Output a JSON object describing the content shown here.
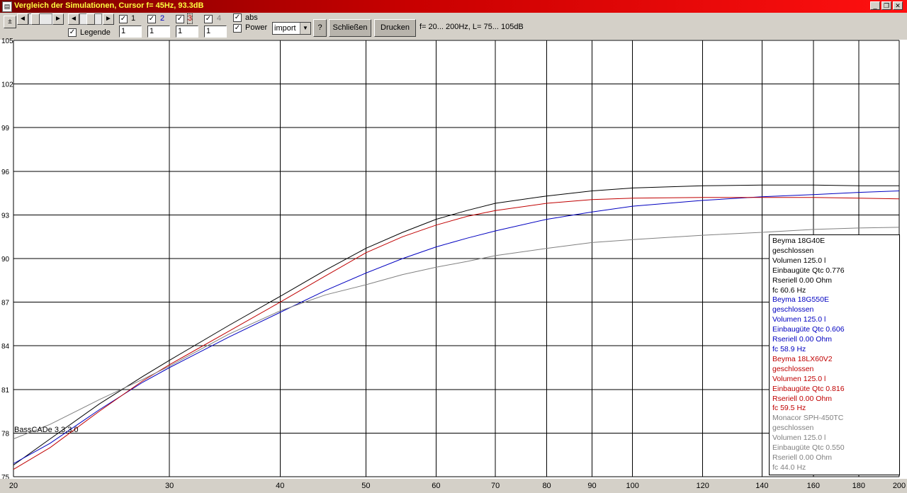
{
  "window": {
    "title": "Vergleich der Simulationen, Cursor f= 45Hz, 93.3dB",
    "icon": "document-icon"
  },
  "toolbar": {
    "plusminus_label": "±",
    "left_arrow": "◄",
    "right_arrow": "►",
    "legend_label": "Legende",
    "legend_checked": true,
    "series_toggles": [
      {
        "label": "1",
        "checked": true,
        "color": "#000000"
      },
      {
        "label": "2",
        "checked": true,
        "color": "#0000c0"
      },
      {
        "label": "3",
        "checked": true,
        "color": "#c00000"
      },
      {
        "label": "4",
        "checked": true,
        "color": "#808080"
      }
    ],
    "multipliers": [
      "1",
      "1",
      "1",
      "1"
    ],
    "abs_label": "abs",
    "abs_checked": true,
    "power_label": "Power",
    "power_checked": true,
    "import_value": "import",
    "help_label": "?",
    "close_label": "Schließen",
    "print_label": "Drucken",
    "range_info": "f=  20... 200Hz, L= 75... 105dB"
  },
  "chart_data": {
    "type": "line",
    "x_scale": "log",
    "xlim": [
      20,
      200
    ],
    "ylim": [
      75,
      105
    ],
    "x_ticks": [
      20,
      30,
      40,
      50,
      60,
      70,
      80,
      90,
      100,
      120,
      140,
      160,
      180,
      200
    ],
    "y_ticks": [
      75,
      78,
      81,
      84,
      87,
      90,
      93,
      96,
      99,
      102,
      105
    ],
    "grid": true,
    "legend_position": "bottom-right",
    "series": [
      {
        "color": "#000000",
        "x": [
          20,
          22,
          25,
          28,
          30,
          35,
          40,
          45,
          50,
          55,
          60,
          65,
          70,
          80,
          90,
          100,
          120,
          140,
          160,
          180,
          200
        ],
        "y": [
          75.8,
          77.6,
          80.0,
          81.9,
          83.0,
          85.4,
          87.4,
          89.2,
          90.7,
          91.8,
          92.7,
          93.3,
          93.8,
          94.3,
          94.65,
          94.85,
          95.0,
          95.05,
          95.05,
          95.0,
          95.0
        ]
      },
      {
        "color": "#0000c0",
        "x": [
          20,
          22,
          25,
          28,
          30,
          35,
          40,
          45,
          50,
          55,
          60,
          65,
          70,
          80,
          90,
          100,
          120,
          140,
          160,
          180,
          200
        ],
        "y": [
          75.9,
          77.3,
          79.6,
          81.5,
          82.5,
          84.6,
          86.3,
          87.8,
          89.0,
          90.0,
          90.8,
          91.4,
          91.9,
          92.7,
          93.2,
          93.6,
          94.0,
          94.25,
          94.4,
          94.55,
          94.65
        ]
      },
      {
        "color": "#c00000",
        "x": [
          20,
          22,
          25,
          28,
          30,
          35,
          40,
          45,
          50,
          55,
          60,
          65,
          70,
          80,
          90,
          100,
          120,
          140,
          160,
          180,
          200
        ],
        "y": [
          75.5,
          77.0,
          79.5,
          81.6,
          82.7,
          85.0,
          87.0,
          88.8,
          90.4,
          91.5,
          92.3,
          92.9,
          93.3,
          93.8,
          94.05,
          94.15,
          94.2,
          94.2,
          94.2,
          94.15,
          94.1
        ]
      },
      {
        "color": "#808080",
        "x": [
          20,
          22,
          25,
          28,
          30,
          35,
          40,
          45,
          50,
          55,
          60,
          65,
          70,
          80,
          90,
          100,
          120,
          140,
          160,
          180,
          200
        ],
        "y": [
          77.6,
          78.6,
          80.3,
          81.7,
          82.6,
          84.8,
          86.4,
          87.5,
          88.2,
          88.9,
          89.4,
          89.8,
          90.2,
          90.7,
          91.1,
          91.3,
          91.6,
          91.8,
          92.0,
          92.1,
          92.15
        ]
      }
    ],
    "legend_entries": [
      {
        "color": "#000000",
        "lines": [
          "Beyma 18G40E",
          "geschlossen",
          "Volumen 125.0 l",
          "Einbaugüte Qtc 0.776",
          "Rseriell 0.00 Ohm",
          "fc 60.6 Hz"
        ]
      },
      {
        "color": "#0000c0",
        "lines": [
          "Beyma 18G550E",
          "geschlossen",
          "Volumen 125.0 l",
          "Einbaugüte Qtc 0.606",
          "Rseriell 0.00 Ohm",
          "fc 58.9 Hz"
        ]
      },
      {
        "color": "#c00000",
        "lines": [
          "Beyma 18LX60V2",
          "geschlossen",
          "Volumen 125.0 l",
          "Einbaugüte Qtc 0.816",
          "Rseriell 0.00 Ohm",
          "fc 59.5 Hz"
        ]
      },
      {
        "color": "#808080",
        "lines": [
          "Monacor SPH-450TC",
          "geschlossen",
          "Volumen 125.0 l",
          "Einbaugüte Qtc 0.550",
          "Rseriell 0.00 Ohm",
          "fc 44.0 Hz"
        ]
      }
    ],
    "annotation": "BassCADe 3.3.3.0"
  }
}
